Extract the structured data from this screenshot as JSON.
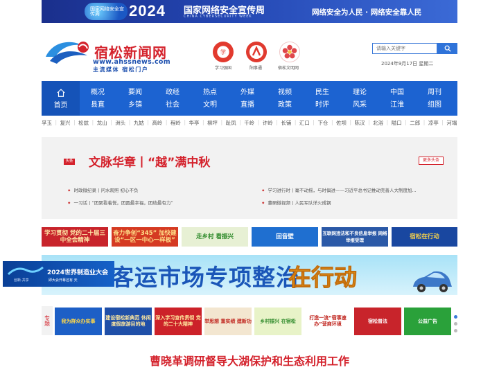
{
  "top_banner": {
    "badge": "国家网络安全宣传周",
    "year": "2024",
    "title": "国家网络安全宣传周",
    "subtitle": "CHINA CYBERSECURITY WEEK",
    "slogan": "网络安全为人民 · 网络安全靠人民"
  },
  "header": {
    "site_name": "宿松新闻网",
    "url": "www.ahssnews.com",
    "slogan": "主流媒体 宿松门户",
    "apps": [
      "学习强国",
      "阳事通",
      "宿松文明网"
    ],
    "search_placeholder": "请输入关键字",
    "date": "2024年9月17日 星期二"
  },
  "nav": {
    "home": "首页",
    "columns": [
      [
        "概况",
        "县直"
      ],
      [
        "要闻",
        "乡镇"
      ],
      [
        "政经",
        "社会"
      ],
      [
        "热点",
        "文明"
      ],
      [
        "外媒",
        "直播"
      ],
      [
        "视频",
        "政策"
      ],
      [
        "民生",
        "时评"
      ],
      [
        "理论",
        "风采"
      ],
      [
        "中国",
        "江淮"
      ],
      [
        "周刊",
        "组图"
      ]
    ]
  },
  "towns": [
    "孚玉",
    "复兴",
    "松兹",
    "龙山",
    "洲头",
    "九姑",
    "高岭",
    "程岭",
    "华亭",
    "柳坪",
    "趾凤",
    "千岭",
    "许岭",
    "长铺",
    "汇口",
    "下仓",
    "佐坝",
    "陈汉",
    "北浴",
    "隘口",
    "二郎",
    "凉亭",
    "河塌"
  ],
  "headline": {
    "badge": "头条",
    "title": "文脉华章丨“越”满中秋",
    "more": "更多头条",
    "links": [
      "时政微纪录丨问水观照 初心不负",
      "学习进行时丨毫不动摇，与时俱进——习近平总书记推动完善人大制度加...",
      "一习话丨“团聚看着悦，团圆最幸福，团结最有力”",
      "董硐微视频丨人民军队洋火成钢"
    ]
  },
  "banners": [
    {
      "text": "学习贯彻 党的二十届三中全会精神",
      "bg": "#c8242b",
      "color": "#ffe9a8"
    },
    {
      "text": "奋力争创“345” 加快建设“一区一中心一样板”",
      "bg": "#d53a22",
      "color": "#ffe08a"
    },
    {
      "text": "走乡村 看振兴",
      "bg": "#e7f0d4",
      "color": "#2e8a2a"
    },
    {
      "text": "回音壁",
      "bg": "#1f6fd0",
      "color": "#ffffff"
    },
    {
      "text": "互联网违法和不良信息举报 网络举报受理",
      "bg": "#2b59a7",
      "color": "#ffffff"
    },
    {
      "text": "宿松在行动",
      "bg": "#1947a0",
      "color": "#f6d24a"
    }
  ],
  "big_ad": {
    "text": "客运市场专项整治",
    "highlight": "在行动"
  },
  "float_ad": {
    "title": "2024世界制造业大会",
    "sub1": "创新·共享",
    "sub2": "即大会开幕还有 天"
  },
  "topics": {
    "label": "专题",
    "cards": [
      {
        "text": "我为群众办实事",
        "bg": "#1d5fc6",
        "color": "#ffd84a"
      },
      {
        "text": "建设宿松新典范 休闲度假旅游目的地",
        "bg": "#1f4fa8",
        "color": "#ffe8a0"
      },
      {
        "text": "深入学习宣传贯彻 党的二十大精神",
        "bg": "#cc2229",
        "color": "#ffeaa0"
      },
      {
        "text": "举思想 重实绩 建新功",
        "bg": "#f3e6d0",
        "color": "#c0261f"
      },
      {
        "text": "乡村振兴 在宿松",
        "bg": "#e8f3c8",
        "color": "#2e8a2a"
      },
      {
        "text": "打造一流“宿事速办”营商环境",
        "bg": "#ffffff",
        "color": "#c0261f"
      },
      {
        "text": "宿松普法",
        "bg": "#c8242b",
        "color": "#ffffff"
      },
      {
        "text": "公益广告",
        "bg": "#2aa13a",
        "color": "#ffffff"
      }
    ]
  },
  "bottom_headline": "曹晓革调研督导大湖保护和生态利用工作"
}
